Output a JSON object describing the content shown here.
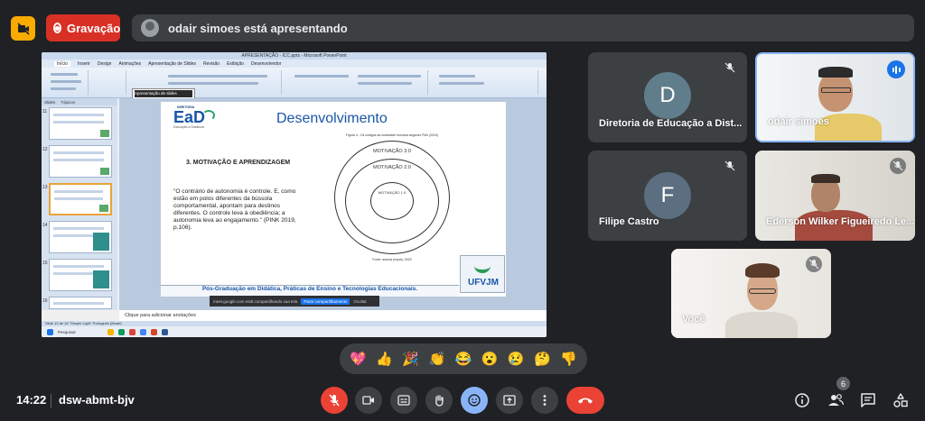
{
  "top_bar": {
    "recording_label": "Gravação",
    "presenter_banner": "odair simoes está apresentando"
  },
  "shared_screen": {
    "window_title": "APRESENTAÇÃO - ICC.pptx - Microsoft PowerPoint",
    "menu_items": [
      "Início",
      "Inserir",
      "Design",
      "Animações",
      "Apresentação de Slides",
      "Revisão",
      "Exibição",
      "Desenvolvedor"
    ],
    "slide_menu": [
      "Apresentação de slides",
      "Iniciar apresentação de slides"
    ],
    "thumb_tabs": [
      "Slides",
      "Tópicos"
    ],
    "thumb_numbers": [
      "11",
      "12",
      "13",
      "14",
      "15",
      "16"
    ],
    "notes_placeholder": "Clique para adicionar anotações",
    "status_text": "Slide 13 de 16   \"Simple Light\"   Português (Brasil)",
    "taskbar_search": "Pesquisar",
    "share_bar_url": "meet.google.com está compartilhando sua tela",
    "share_bar_stop": "Parar compartilhamento",
    "share_bar_hide": "Ocultar",
    "slide": {
      "logo_small": "DIRETORIA",
      "logo_main": "EaD",
      "logo_sub": "Educação a Distância",
      "title": "Desenvolvimento",
      "section": "3. MOTIVAÇÃO E APRENDIZAGEM",
      "quote": "\"O contrário de autonomia é controle. E, como estão em polos diferentes da bússola comportamental, apontam para destinos diferentes. O controle leva à obediência; a autonomia leva ao engajamento.\" (PINK 2019, p.106).",
      "figure_caption": "Figura 4 - Os códigos da sociedade humana segundo Pink (2019)",
      "circle_outer": "MOTIVAÇÃO 3.0",
      "circle_middle": "MOTIVAÇÃO 2.0",
      "circle_inner": "MOTIVAÇÃO 1.0",
      "figure_source": "Fonte: autoria própria, 2023",
      "footer": "Pós-Graduação em Didática, Práticas de Ensino e Tecnologias Educacionais.",
      "ufvjm": "UFVJM"
    }
  },
  "participants": [
    {
      "name": "Diretoria de Educação a Dist...",
      "initial": "D",
      "color": "#607d8b"
    },
    {
      "name": "odair simoes"
    },
    {
      "name": "Filipe Castro",
      "initial": "F",
      "color": "#5c6f80"
    },
    {
      "name": "Ederson Wilker Figueiredo Le..."
    },
    {
      "name": "Você"
    }
  ],
  "reactions": [
    "💖",
    "👍",
    "🎉",
    "👏",
    "😂",
    "😮",
    "😢",
    "🤔",
    "👎"
  ],
  "bottom_bar": {
    "time": "14:22",
    "meeting_code": "dsw-abmt-bjv",
    "participant_count": "6"
  }
}
